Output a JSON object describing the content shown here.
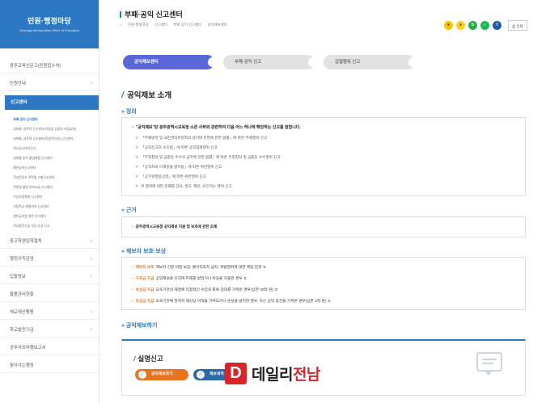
{
  "sidebar": {
    "brand_title": "민원·행정마당",
    "brand_subtitle": "Gwangju Metropolitan Office of Education",
    "items": [
      {
        "label": "광주교육신문고(민원접수처)",
        "chevron": ""
      },
      {
        "label": "민원안내",
        "chevron": "›"
      },
      {
        "label": "중고학생입학절차",
        "chevron": "›"
      },
      {
        "label": "행정규칙운영",
        "chevron": "›"
      },
      {
        "label": "입찰정보",
        "chevron": "›"
      },
      {
        "label": "물품관리현황",
        "chevron": ""
      },
      {
        "label": "체교재산활용",
        "chevron": "›"
      },
      {
        "label": "학교발전기금",
        "chevron": "›"
      },
      {
        "label": "공무국외여행보고서",
        "chevron": ""
      },
      {
        "label": "찾아가는행정",
        "chevron": ""
      }
    ],
    "active_label": "신고센터",
    "active_toggle": "∨",
    "sub_items": [
      "- 부패·공익 신고센터",
      "- 성희롱, 성폭력 신고센터(직원및 공립외 사립교원)",
      "- 성희롱, 성폭력 신고센터(학생/학부모) 신고센터",
      "- 학교급식비리신고",
      "- 성희롱 방지 불법채용 신고센터",
      "- 예산낭비신고센터",
      "- 학교운동부 폭력및 고충신고센터",
      "- 학원및 불법 과외교습 신고센터",
      "- 수능부정행위 신고센터",
      "- 사립학교 채용비리 신고센터",
      "- 청탁금지법 위반 신고센터",
      "- 학교발전기금 부당 조성 신고"
    ]
  },
  "header": {
    "title": "부패·공익 신고센터",
    "breadcrumb": [
      "⌂",
      "민원·행정마당",
      "신고센터",
      "부패·공익 신고센터",
      "공익제보센터"
    ],
    "print_label": "인쇄",
    "social_icons": [
      {
        "name": "kakao-story",
        "color": "#f5c400",
        "glyph": "●"
      },
      {
        "name": "kakao-talk",
        "color": "#f9d21b",
        "glyph": "●"
      },
      {
        "name": "band",
        "color": "#2ea84a",
        "glyph": "b"
      },
      {
        "name": "line",
        "color": "#1db954",
        "glyph": "○"
      },
      {
        "name": "facebook",
        "color": "#1f5ab0",
        "glyph": "f"
      }
    ]
  },
  "tabs": [
    {
      "label": "공익제보센터",
      "active": true
    },
    {
      "label": "부패·공익 신고",
      "active": false
    },
    {
      "label": "갑질행위 신고",
      "active": false
    }
  ],
  "main": {
    "section_title": "공익제보 소개",
    "definition": {
      "heading": "정의",
      "lead": "\"공익제보\"란 광주광역시교육청 소관 사무와 관련하여 다음 어느 하나에 해당하는 신고를 말합니다.",
      "items": [
        "「부패방지 및 국민권익위원회의 설치와 운영에 관한 법률」에 따른 부패행위 신고",
        "「공익신고자 보호법」에 따른 공익침해행위 신고",
        "「부정청탁 및 금품등 수수의 금지에 관한 법률」에 따른 부정청탁 및 금품등 수수행위 신고",
        "「공직자의 이해충돌 방지법」에 따른 위반행위 신고",
        "「공무원행동강령」에 따른 위반행위 신고",
        "위 행위에 대한 은폐를 강요, 권고, 제의, 유인하는 행위 신고"
      ],
      "item_prefixes": [
        "①",
        "②",
        "③",
        "④",
        "⑤",
        "⑥"
      ]
    },
    "basis": {
      "heading": "근거",
      "text": "광주광역시교육청 공익제보 지원 및 보호에 관한 조례"
    },
    "protection": {
      "heading": "제보자 보호·보상",
      "items": [
        {
          "key": "제보자 보호",
          "text": "제보자 신분 비밀 보장, 불이익조치 금지, 위법행위에 대한 책임 감경"
        },
        {
          "key": "구조금 지급",
          "text": "공익제보로 인하여 피해를 받았거나 비용을 지출한 경우"
        },
        {
          "key": "보상금 지급",
          "text": "교육기관의 재정에 직접적인 수입의 회복·증대를 가져온 경우(상한 30억 원)"
        },
        {
          "key": "포상금 지급",
          "text": "교육기관에 현저히 재산상 이익을 가져오거나 손실을 방지한 경우, 또는 공익 증진을 가져온 경우(상한 2억 원)"
        }
      ]
    },
    "report": {
      "heading": "공익제보하기",
      "box_title": "실명신고",
      "buttons": [
        {
          "label": "공익제보하기",
          "color": "#e8741e"
        },
        {
          "label": "제보내역",
          "color": "#2a6aa8"
        }
      ]
    }
  },
  "watermark": {
    "logo_glyph": "D",
    "text_black": "데일리",
    "text_red": "전남"
  }
}
